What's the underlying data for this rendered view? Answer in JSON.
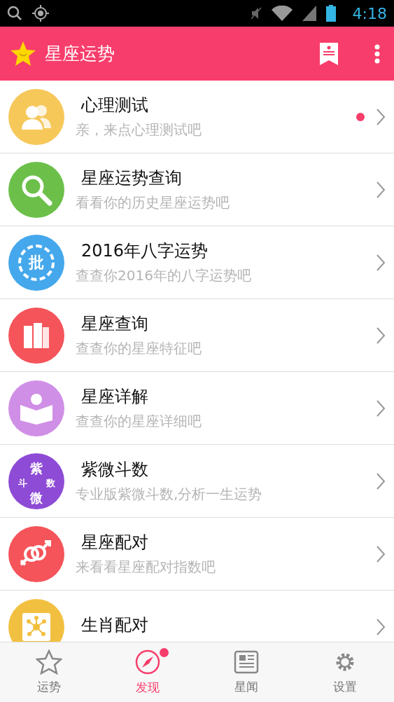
{
  "status_bar": {
    "time": "4:18"
  },
  "header": {
    "title": "星座运势"
  },
  "items": [
    {
      "title": "心理测试",
      "subtitle": "亲，来点心理测试吧",
      "kind": "people",
      "color": "#f6c85a",
      "badge": true
    },
    {
      "title": "星座运势查询",
      "subtitle": "看看你的历史星座运势吧",
      "kind": "search",
      "color": "#6cc04a",
      "badge": false
    },
    {
      "title": "2016年八字运势",
      "subtitle": "查查你2016年的八字运势吧",
      "kind": "seal",
      "color": "#45a8ec",
      "badge": false,
      "icon_text": [
        "批"
      ]
    },
    {
      "title": "星座查询",
      "subtitle": "查查你的星座特征吧",
      "kind": "books",
      "color": "#f4545a",
      "badge": false
    },
    {
      "title": "星座详解",
      "subtitle": "查查你的星座详细吧",
      "kind": "reader",
      "color": "#d08fe6",
      "badge": false
    },
    {
      "title": "紫微斗数",
      "subtitle": "专业版紫微斗数,分析一生运势",
      "kind": "ziwei",
      "color": "#8e4bd6",
      "badge": false,
      "icon_text": [
        "紫",
        "斗",
        "数",
        "微"
      ]
    },
    {
      "title": "星座配对",
      "subtitle": "来看看星座配对指数吧",
      "kind": "gender",
      "color": "#f4545a",
      "badge": false
    },
    {
      "title": "生肖配对",
      "kind": "network",
      "color": "#f2c040",
      "badge": false
    }
  ],
  "bottom_nav": [
    {
      "label": "运势",
      "kind": "star",
      "selected": false,
      "badge": false
    },
    {
      "label": "发现",
      "kind": "compass",
      "selected": true,
      "badge": true
    },
    {
      "label": "星闻",
      "kind": "news",
      "selected": false,
      "badge": false
    },
    {
      "label": "设置",
      "kind": "gear",
      "selected": false,
      "badge": false
    }
  ]
}
